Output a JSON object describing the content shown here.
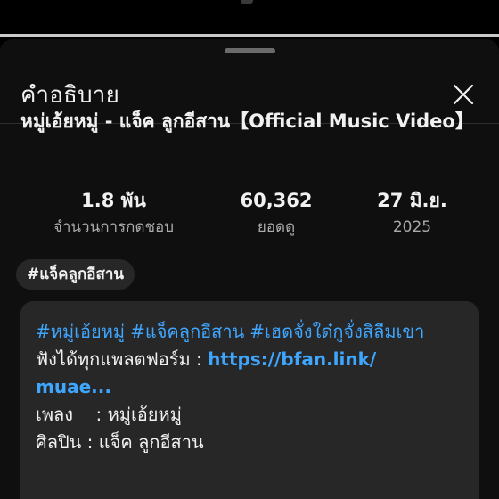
{
  "sheet": {
    "title": "คำอธิบาย"
  },
  "video": {
    "title": "หมู่เอ้ยหมู่ - แจ็ค ลูกอีสาน【Official Music Video】"
  },
  "stats": [
    {
      "value": "1.8 พัน",
      "label": "จำนวนการกดชอบ"
    },
    {
      "value": "60,362",
      "label": "ยอดดู"
    },
    {
      "value": "27 มิ.ย.",
      "label": "2025"
    }
  ],
  "chip": {
    "label": "#แจ็คลูกอีสาน"
  },
  "description": {
    "hashtags": [
      "#หมู่เอ้ยหมู่",
      "#แจ็คลูกอีสาน",
      "#เฮดจั่งใด๋กูจั่งสิลืมเขา"
    ],
    "platforms_prefix": "ฟังได้ทุกแพลตฟอร์ม : ",
    "link_part1": "https://bfan.link/",
    "link_part2": "muae...",
    "song_label": "เพลง    : ",
    "song_value": "หมู่เอ้ยหมู่",
    "artist_label": "ศิลปิน : ",
    "artist_value": "แจ็ค ลูกอีสาน"
  },
  "colors": {
    "background": "#0f0f0f",
    "card": "#272727",
    "link": "#3ea6ff",
    "text": "#f1f1f1",
    "secondary_text": "#aaaaaa"
  },
  "icons": {
    "close": "close-icon"
  }
}
